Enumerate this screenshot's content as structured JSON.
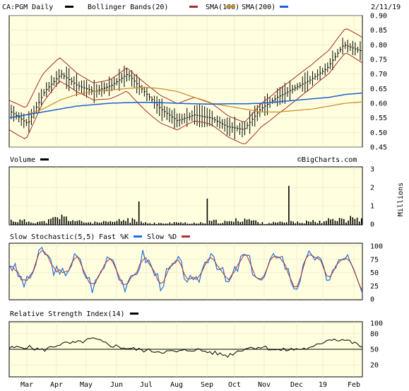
{
  "header": {
    "symbol_label": "CA:PGM Daily",
    "date": "2/11/19"
  },
  "legend": {
    "price_series": "CA:PGM Daily",
    "bollinger": "Bollinger Bands(20)",
    "sma100": "SMA(100)",
    "sma200": "SMA(200)"
  },
  "colors": {
    "panel_bg": "#ffffe0",
    "grid": "#e3e3c3",
    "price": "#000000",
    "bollinger": "#a52a2a",
    "sma100": "#8b1a1a",
    "sma200": "#cc8a1e",
    "sma200_blue": "#1f5fd0",
    "stoch_fast": "#1e6fe0",
    "stoch_slow": "#b03030",
    "rsi": "#000000"
  },
  "volume_panel": {
    "title": "Volume",
    "watermark": "©BigCharts.com",
    "unit": "Millions"
  },
  "stochastic_panel": {
    "title": "Slow Stochastic(5,5)",
    "fast": "Fast %K",
    "slow": "Slow %D"
  },
  "rsi_panel": {
    "title": "Relative Strength Index(14)"
  },
  "chart_data": [
    {
      "type": "line",
      "title": "CA:PGM Daily",
      "x": [
        "Mar",
        "Apr",
        "May",
        "Jun",
        "Jul",
        "Aug",
        "Sep",
        "Oct",
        "Nov",
        "Dec",
        "19",
        "Feb"
      ],
      "ylim": [
        0.45,
        0.9
      ],
      "yticks": [
        "0.45",
        "0.50",
        "0.55",
        "0.60",
        "0.65",
        "0.70",
        "0.75",
        "0.80",
        "0.85",
        "0.90"
      ],
      "series": [
        {
          "name": "CA:PGM Daily",
          "values": [
            0.57,
            0.53,
            0.64,
            0.7,
            0.66,
            0.64,
            0.66,
            0.7,
            0.64,
            0.58,
            0.54,
            0.56,
            0.55,
            0.52,
            0.51,
            0.58,
            0.62,
            0.65,
            0.68,
            0.72,
            0.8,
            0.78
          ]
        },
        {
          "name": "SMA(200)",
          "values": [
            0.55,
            0.56,
            0.57,
            0.58,
            0.59,
            0.595,
            0.6,
            0.602,
            0.603,
            0.602,
            0.6,
            0.598,
            0.597,
            0.598,
            0.598,
            0.6,
            0.605,
            0.61,
            0.615,
            0.62,
            0.63,
            0.635
          ]
        },
        {
          "name": "SMA(100)",
          "values": [
            0.55,
            0.56,
            0.58,
            0.61,
            0.63,
            0.64,
            0.645,
            0.65,
            0.655,
            0.65,
            0.64,
            0.62,
            0.6,
            0.59,
            0.58,
            0.57,
            0.57,
            0.575,
            0.58,
            0.59,
            0.6,
            0.605
          ]
        }
      ]
    },
    {
      "type": "bar",
      "title": "Volume",
      "x": [
        "Mar",
        "Apr",
        "May",
        "Jun",
        "Jul",
        "Aug",
        "Sep",
        "Oct",
        "Nov",
        "Dec",
        "19",
        "Feb"
      ],
      "ylim": [
        0,
        3
      ],
      "yticks": [
        "0",
        "1",
        "2",
        "3"
      ],
      "ylabel": "Millions",
      "series": [
        {
          "name": "Volume",
          "values": [
            0.25,
            0.2,
            0.15,
            0.45,
            0.18,
            0.12,
            0.15,
            0.3,
            0.1,
            0.08,
            0.12,
            0.1,
            0.2,
            0.15,
            0.35,
            0.1,
            0.12,
            0.15,
            0.2,
            0.25,
            0.3,
            0.45
          ]
        }
      ]
    },
    {
      "type": "line",
      "title": "Slow Stochastic(5,5)",
      "x": [
        "Mar",
        "Apr",
        "May",
        "Jun",
        "Jul",
        "Aug",
        "Sep",
        "Oct",
        "Nov",
        "Dec",
        "19",
        "Feb"
      ],
      "ylim": [
        0,
        100
      ],
      "yticks": [
        "0",
        "25",
        "50",
        "75",
        "100"
      ],
      "series": [
        {
          "name": "Fast %K",
          "values": [
            70,
            25,
            95,
            40,
            80,
            20,
            90,
            15,
            85,
            30,
            70,
            20,
            95,
            25,
            85,
            30,
            95,
            20,
            90,
            40,
            85,
            10
          ]
        },
        {
          "name": "Slow %D",
          "values": [
            60,
            35,
            85,
            45,
            75,
            30,
            80,
            25,
            75,
            35,
            65,
            30,
            85,
            30,
            80,
            35,
            85,
            30,
            80,
            45,
            80,
            30
          ]
        }
      ]
    },
    {
      "type": "line",
      "title": "Relative Strength Index(14)",
      "x": [
        "Mar",
        "Apr",
        "May",
        "Jun",
        "Jul",
        "Aug",
        "Sep",
        "Oct",
        "Nov",
        "Dec",
        "19",
        "Feb"
      ],
      "ylim": [
        0,
        100
      ],
      "yticks": [
        "0",
        "50",
        "100"
      ],
      "series": [
        {
          "name": "Relative Strength Index(14)",
          "values": [
            52,
            55,
            48,
            60,
            62,
            70,
            58,
            52,
            48,
            46,
            45,
            50,
            44,
            38,
            52,
            55,
            48,
            50,
            52,
            70,
            68,
            55
          ]
        }
      ]
    }
  ],
  "x_axis": [
    "Mar",
    "Apr",
    "May",
    "Jun",
    "Jul",
    "Aug",
    "Sep",
    "Oct",
    "Nov",
    "Dec",
    "19",
    "Feb"
  ],
  "price_axis": [
    "0.90",
    "0.85",
    "0.80",
    "0.75",
    "0.70",
    "0.65",
    "0.60",
    "0.55",
    "0.50",
    "0.45"
  ],
  "volume_axis": [
    "3",
    "2",
    "1",
    "0"
  ],
  "stoch_axis": [
    "100",
    "75",
    "50",
    "25",
    "0"
  ],
  "rsi_axis": [
    "100",
    "80",
    "50",
    "20"
  ]
}
